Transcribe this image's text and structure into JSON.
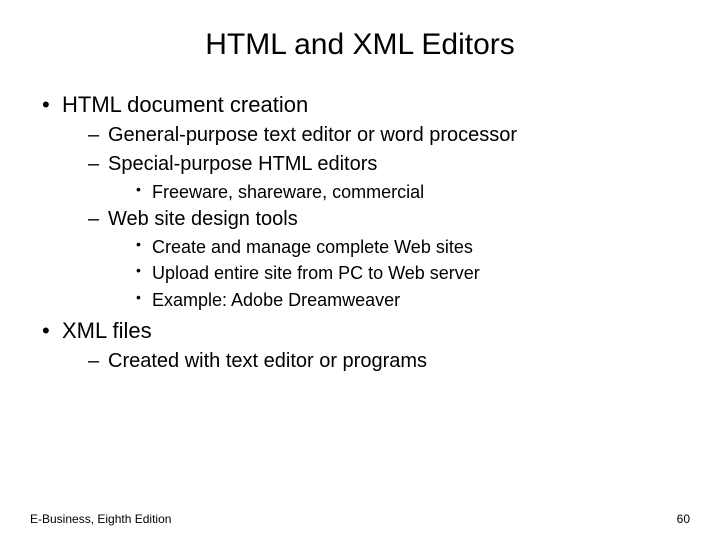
{
  "title": "HTML and XML Editors",
  "bullets": {
    "b1": "HTML document creation",
    "b1_1": "General-purpose text editor or word processor",
    "b1_2": "Special-purpose HTML editors",
    "b1_2_1": "Freeware, shareware, commercial",
    "b1_3": "Web site design tools",
    "b1_3_1": "Create and manage complete Web sites",
    "b1_3_2": "Upload entire site from PC to Web server",
    "b1_3_3": "Example: Adobe Dreamweaver",
    "b2": "XML files",
    "b2_1": "Created with text editor or programs"
  },
  "footer": {
    "left": "E-Business, Eighth Edition",
    "right": "60"
  }
}
